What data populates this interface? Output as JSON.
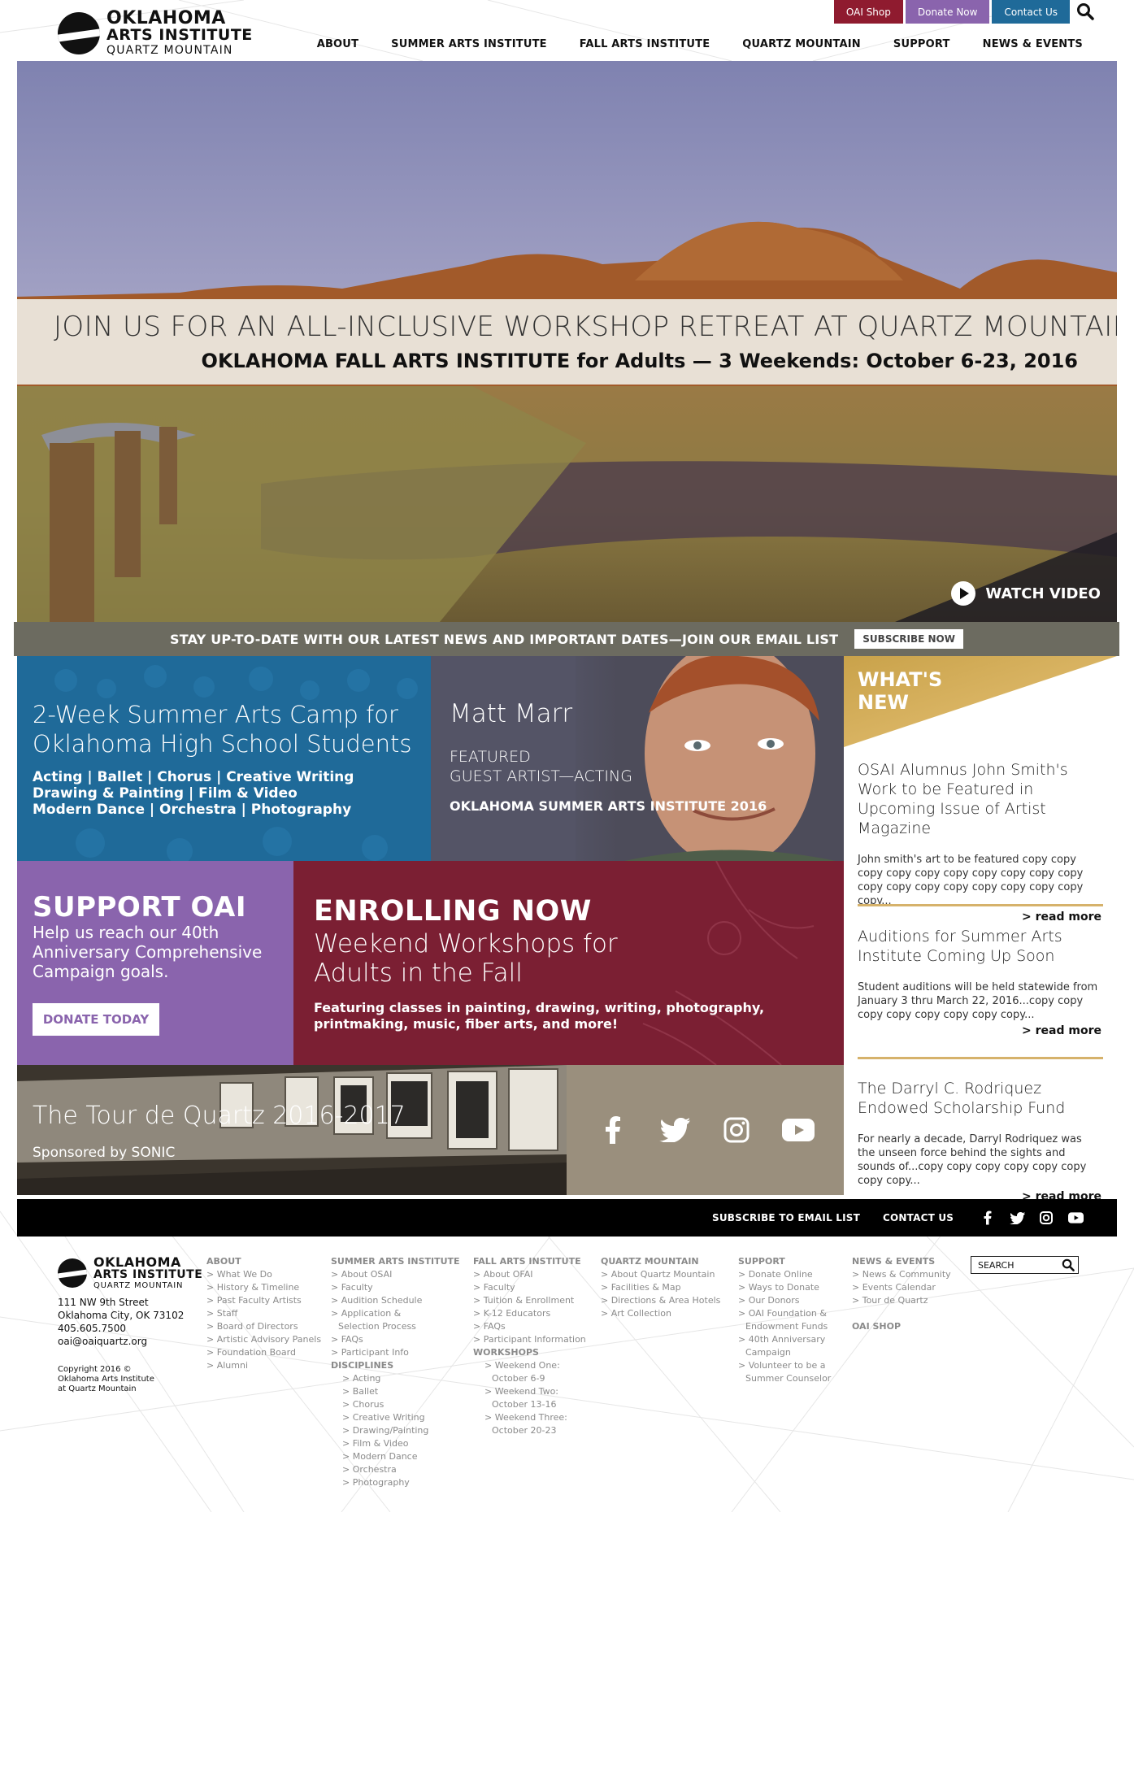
{
  "header": {
    "logo": {
      "line1": "OKLAHOMA",
      "line2": "ARTS INSTITUTE",
      "line3": "QUARTZ MOUNTAIN"
    },
    "top_buttons": [
      {
        "label": "OAI Shop",
        "color": "#8f1b2f"
      },
      {
        "label": "Donate Now",
        "color": "#8a64ad"
      },
      {
        "label": "Contact Us",
        "color": "#1f6a99"
      }
    ],
    "search_icon": "search-icon",
    "nav": [
      "ABOUT",
      "SUMMER ARTS INSTITUTE",
      "FALL ARTS INSTITUTE",
      "QUARTZ MOUNTAIN",
      "SUPPORT",
      "NEWS & EVENTS"
    ]
  },
  "hero": {
    "headline": "JOIN US FOR AN ALL-INCLUSIVE WORKSHOP RETREAT AT QUARTZ MOUNTAIN.",
    "subline": "OKLAHOMA FALL ARTS INSTITUTE for Adults — 3 Weekends: October 6-23, 2016",
    "watch_video": "WATCH VIDEO"
  },
  "email_strip": {
    "text": "STAY UP-TO-DATE WITH OUR LATEST NEWS AND IMPORTANT DATES—JOIN OUR EMAIL LIST",
    "button": "SUBSCRIBE NOW"
  },
  "tiles": {
    "camp": {
      "title": "2-Week Summer Arts Camp for Oklahoma High School Students",
      "line1": "Acting | Ballet | Chorus | Creative Writing",
      "line2": "Drawing & Painting | Film & Video",
      "line3": "Modern Dance | Orchestra | Photography"
    },
    "artist": {
      "name": "Matt Marr",
      "role1": "FEATURED",
      "role2": "GUEST ARTIST—ACTING",
      "institute": "OKLAHOMA SUMMER ARTS INSTITUTE 2016"
    },
    "support": {
      "title": "SUPPORT OAI",
      "body": "Help us reach our 40th Anniversary Comprehensive Campaign goals.",
      "button": "DONATE TODAY"
    },
    "enroll": {
      "title": "ENROLLING NOW",
      "subtitle": "Weekend Workshops for Adults in the Fall",
      "body": "Featuring classes in painting, drawing, writing, photography, printmaking, music, fiber arts, and more!"
    },
    "tour": {
      "title": "The Tour de Quartz 2016-2017",
      "sponsor": "Sponsored by SONIC"
    },
    "social": [
      "facebook-icon",
      "twitter-icon",
      "instagram-icon",
      "youtube-icon"
    ]
  },
  "whats_new": {
    "title_line1": "WHAT'S",
    "title_line2": "NEW",
    "items": [
      {
        "headline": "OSAI Alumnus John Smith's Work to be Featured in Upcoming Issue of Artist Magazine",
        "body": "John smith's art to be featured copy copy copy copy copy copy copy copy copy copy copy copy copy copy copy copy copy copy copy...",
        "more": "> read more"
      },
      {
        "headline": "Auditions for Summer Arts Institute Coming Up Soon",
        "body": "Student auditions will be held statewide from January 3 thru March 22, 2016...copy copy copy copy copy copy copy copy...",
        "more": "> read more"
      },
      {
        "headline": "The Darryl C. Rodriquez Endowed Scholarship Fund",
        "body": "For nearly a decade, Darryl Rodriquez was the unseen force behind the sights and sounds of...copy copy copy copy copy copy copy copy...",
        "more": "> read more"
      }
    ]
  },
  "footer_bar": {
    "subscribe": "SUBSCRIBE TO EMAIL LIST",
    "contact": "CONTACT US",
    "icons": [
      "facebook-icon",
      "twitter-icon",
      "instagram-icon",
      "youtube-icon"
    ]
  },
  "footer": {
    "address1": "111 NW 9th Street",
    "address2": "Oklahoma City, OK 73102",
    "phone": "405.605.7500",
    "email": "oai@oaiquartz.org",
    "copy1": "Copyright 2016 ©",
    "copy2": "Oklahoma Arts Institute",
    "copy3": "at Quartz Mountain",
    "search_placeholder": "SEARCH",
    "columns": [
      {
        "heading": "ABOUT",
        "items": [
          "> What We Do",
          "> History & Timeline",
          "> Past Faculty Artists",
          "> Staff",
          "> Board of Directors",
          "> Artistic Advisory Panels",
          "> Foundation Board",
          "> Alumni"
        ]
      },
      {
        "heading": "SUMMER ARTS INSTITUTE",
        "items": [
          "> About OSAI",
          "> Faculty",
          "> Audition Schedule",
          "> Application &",
          "Selection Process",
          "> FAQs",
          "> Participant Info"
        ],
        "sub_heading": "DISCIPLINES",
        "sub_items": [
          "> Acting",
          "> Ballet",
          "> Chorus",
          "> Creative Writing",
          "> Drawing/Painting",
          "> Film & Video",
          "> Modern Dance",
          "> Orchestra",
          "> Photography"
        ]
      },
      {
        "heading": "FALL ARTS INSTITUTE",
        "items": [
          "> About OFAI",
          "> Faculty",
          "> Tuition & Enrollment",
          "> K-12 Educators",
          "> FAQs",
          "> Participant Information"
        ],
        "sub_heading": "WORKSHOPS",
        "sub_items": [
          "> Weekend One:",
          "October 6-9",
          "> Weekend Two:",
          "October 13-16",
          "> Weekend Three:",
          "October 20-23"
        ]
      },
      {
        "heading": "QUARTZ MOUNTAIN",
        "items": [
          "> About Quartz Mountain",
          "> Facilities & Map",
          "> Directions & Area Hotels",
          "> Art Collection"
        ]
      },
      {
        "heading": "SUPPORT",
        "items": [
          "> Donate Online",
          "> Ways to Donate",
          "> Our Donors",
          "> OAI Foundation &",
          "Endowment Funds",
          "> 40th Anniversary",
          "Campaign",
          "> Volunteer to be a",
          "Summer Counselor"
        ]
      },
      {
        "heading": "NEWS & EVENTS",
        "items": [
          "> News & Community",
          "> Events Calendar",
          "> Tour de Quartz"
        ],
        "sub_heading": "OAI SHOP"
      }
    ]
  }
}
